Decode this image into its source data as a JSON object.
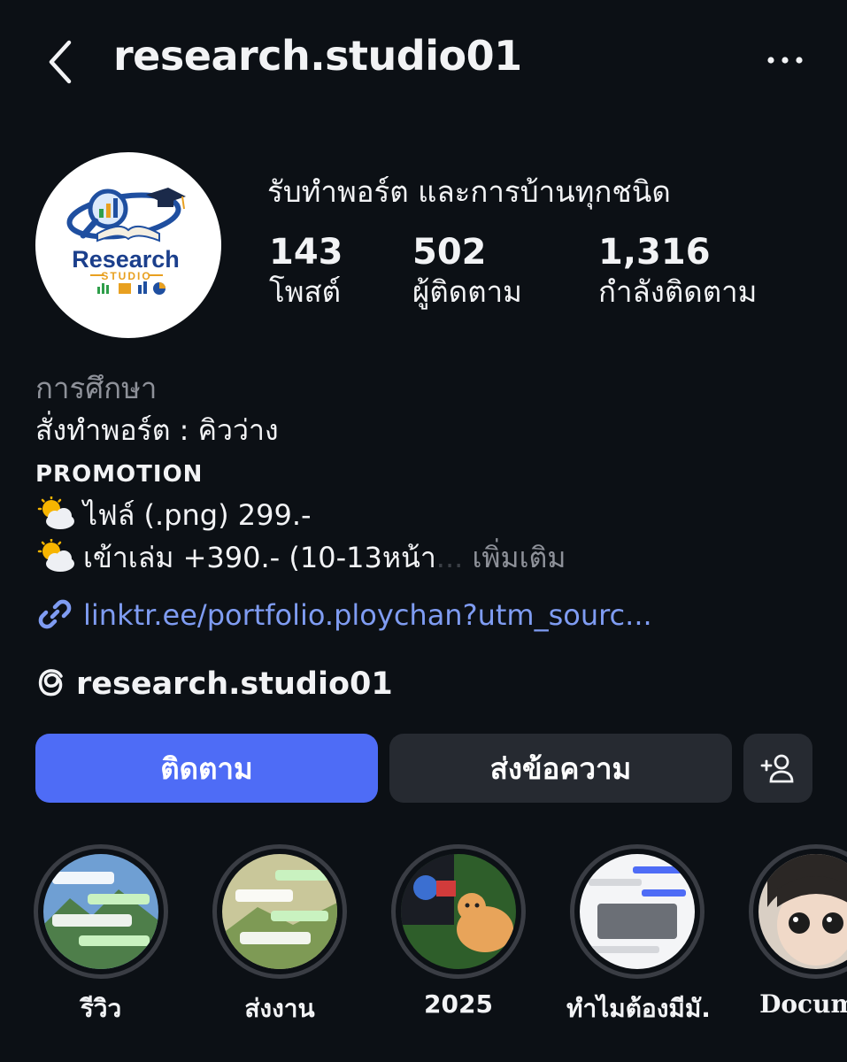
{
  "header": {
    "username": "research.studio01",
    "back_icon": "chevron-left-icon",
    "more_icon": "more-horizontal-icon"
  },
  "profile": {
    "display_name": "รับทำพอร์ต และการบ้านทุกชนิด",
    "avatar_logo": {
      "word": "Research",
      "subword": "STUDIO"
    },
    "stats": [
      {
        "value": "143",
        "label": "โพสต์"
      },
      {
        "value": "502",
        "label": "ผู้ติดตาม"
      },
      {
        "value": "1,316",
        "label": "กำลังติดตาม"
      }
    ]
  },
  "bio": {
    "category": "การศึกษา",
    "line1": "สั่งทำพอร์ต : คิวว่าง",
    "promo": "PROMOTION",
    "line2": "ไฟล์ (.png) 299.-",
    "line3": "เข้าเล่ม +390.- (10-13หน้า",
    "line3_ellipsis": "...",
    "more": "เพิ่มเติม",
    "link": "linktr.ee/portfolio.ploychan?utm_sourc...",
    "threads_handle": "research.studio01"
  },
  "actions": {
    "follow": "ติดตาม",
    "message": "ส่งข้อความ"
  },
  "highlights": [
    {
      "label": "รีวิว"
    },
    {
      "label": "ส่งงาน"
    },
    {
      "label": "2025"
    },
    {
      "label": "ทำไมต้องมีมั..."
    },
    {
      "label": "Docume"
    }
  ],
  "colors": {
    "background": "#0c1015",
    "accent": "#4e6cf6",
    "link": "#7f9cf2",
    "secondary_button": "#262a31",
    "muted_text": "#8e9199"
  }
}
